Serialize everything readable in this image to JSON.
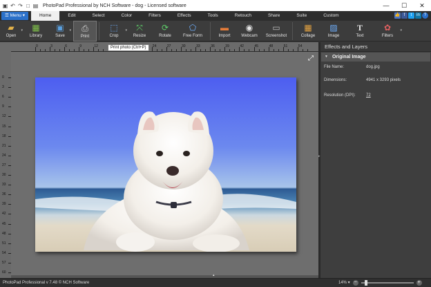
{
  "window": {
    "title": "PhotoPad Professional by NCH Software - dog - Licensed software",
    "controls": {
      "minimize": "—",
      "maximize": "☐",
      "close": "✕"
    }
  },
  "quick_access": [
    "▣",
    "↶",
    "↷",
    "□",
    "▤"
  ],
  "menu_button": "☰ Menu ▾",
  "tabs": [
    "Home",
    "Edit",
    "Select",
    "Color",
    "Filters",
    "Effects",
    "Tools",
    "Retouch",
    "Share",
    "Suite",
    "Custom"
  ],
  "active_tab": "Home",
  "social_icons": [
    "👍",
    "f",
    "t",
    "in",
    "?"
  ],
  "toolbar": {
    "open": "Open",
    "library": "Library",
    "save": "Save",
    "print": "Print",
    "crop": "Crop",
    "resize": "Resize",
    "rotate": "Rotate",
    "free_form": "Free Form",
    "import": "Import",
    "webcam": "Webcam",
    "screenshot": "Screenshot",
    "collage": "Collage",
    "image": "Image",
    "text": "Text",
    "filters": "Filters"
  },
  "tooltip": "Print photo (Ctrl+P)",
  "ruler_top_labels": [
    "0",
    "3",
    "6",
    "9",
    "12",
    "15",
    "18",
    "21",
    "24",
    "27",
    "30",
    "33",
    "36",
    "39",
    "42",
    "45",
    "48",
    "51",
    "54"
  ],
  "ruler_left_labels": [
    "0",
    "3",
    "6",
    "9",
    "12",
    "15",
    "18",
    "21",
    "24",
    "27",
    "30",
    "33",
    "36",
    "39",
    "42",
    "45",
    "48",
    "51",
    "54",
    "57",
    "60",
    "63",
    "66"
  ],
  "panel": {
    "title": "Effects and Layers",
    "section": "Original Image",
    "file_name_label": "File Name:",
    "file_name": "dog.jpg",
    "dimensions_label": "Dimensions:",
    "dimensions": "4941 x 3293 pixels",
    "resolution_label": "Resolution (DPI):",
    "resolution": "72"
  },
  "status": {
    "version": "PhotoPad Professional v 7.48 © NCH Software",
    "zoom": "14% ▾",
    "zoom_level_fraction": 0.07
  },
  "colors": {
    "accent": "#2b70c9",
    "toolbar_bg": "#3c3c3c",
    "canvas_bg": "#6e6e6e"
  }
}
